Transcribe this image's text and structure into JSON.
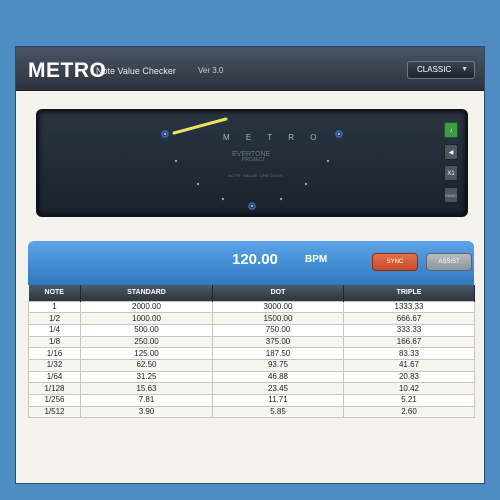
{
  "header": {
    "title": "METRO",
    "subtitle": "Note Value Checker",
    "version": "Ver 3.0",
    "mode_select": {
      "value": "CLASSIC"
    }
  },
  "meter": {
    "brand": "M E T R O",
    "logo": "EVERTONE",
    "logo_sub": "PROJECT",
    "caption": "NOTE VALUE CHECKER",
    "side_buttons": {
      "mult": "X1",
      "panic": "PANIC"
    },
    "icons": [
      "metronome-icon",
      "speaker-icon"
    ]
  },
  "bpm_bar": {
    "value": "120.00",
    "unit": "BPM",
    "sync_label": "SYNC",
    "assist_label": "ASSIST"
  },
  "table": {
    "columns": [
      "NOTE",
      "STANDARD",
      "DOT",
      "TRIPLE"
    ],
    "rows": [
      [
        "1",
        "2000.00",
        "3000.00",
        "1333.33"
      ],
      [
        "1/2",
        "1000.00",
        "1500.00",
        "666.67"
      ],
      [
        "1/4",
        "500.00",
        "750.00",
        "333.33"
      ],
      [
        "1/8",
        "250.00",
        "375.00",
        "166.67"
      ],
      [
        "1/16",
        "125.00",
        "187.50",
        "83.33"
      ],
      [
        "1/32",
        "62.50",
        "93.75",
        "41.67"
      ],
      [
        "1/64",
        "31.25",
        "46.88",
        "20.83"
      ],
      [
        "1/128",
        "15.63",
        "23.45",
        "10.42"
      ],
      [
        "1/256",
        "7.81",
        "11.71",
        "5.21"
      ],
      [
        "1/512",
        "3.90",
        "5.85",
        "2.60"
      ]
    ]
  },
  "colors": {
    "background": "#4f8cc4",
    "header": "#2c333d",
    "bpm_bar": "#3f8bd1",
    "sync": "#d35a35",
    "assist": "#9aa1a9",
    "metronome_button": "#3e9a45",
    "needle": "#f0e060"
  }
}
